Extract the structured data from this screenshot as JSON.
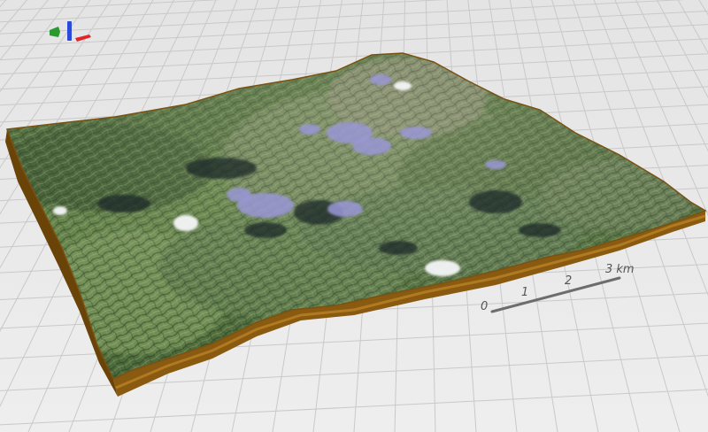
{
  "scene": {
    "background": "#e9e9e9",
    "grid_color": "#c9c9c9",
    "terrain_base_color": "#8a5a10",
    "terrain_base_shadow": "#6a4308"
  },
  "axis_gizmo": {
    "x_color": "#e0262b",
    "y_color": "#2a9a2f",
    "z_color": "#2b4ad8"
  },
  "scale_bar": {
    "ticks": [
      "0",
      "1",
      "2",
      "3 km"
    ],
    "color": "#6d6d6d"
  }
}
